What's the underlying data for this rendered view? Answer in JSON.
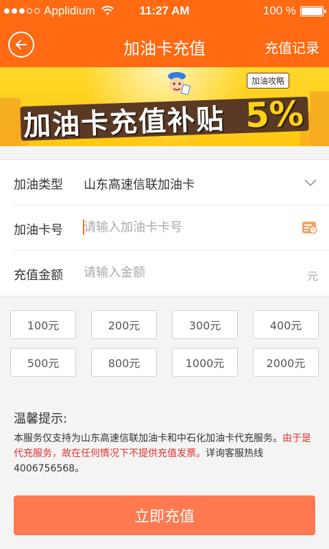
{
  "status_bar": {
    "carrier": "Applidium",
    "time": "11:27 AM",
    "battery": "100 %"
  },
  "nav": {
    "title": "加油卡充值",
    "right_action": "充值记录",
    "back_icon": "back-arrow-icon"
  },
  "banner": {
    "slogan": "加油卡充值补贴",
    "percent": "5%",
    "tag": "加油攻略"
  },
  "form": {
    "type_label": "加油类型",
    "type_value": "山东高速信联加油卡",
    "card_label": "加油卡号",
    "card_placeholder": "请输入加油卡卡号",
    "amount_label": "充值金额",
    "amount_placeholder": "请输入金额",
    "amount_unit": "元"
  },
  "amount_options": [
    "100元",
    "200元",
    "300元",
    "400元",
    "500元",
    "800元",
    "1000元",
    "2000元"
  ],
  "tips": {
    "title": "温馨提示:",
    "text_before": "本服务仅支持为山东高速信联加油卡和中石化加油卡代充服务。",
    "text_red": "由于是代充服务，故在任何情况下不提供充值发票。",
    "text_after": "详询客服热线4006756568。"
  },
  "submit_label": "立即充值",
  "colors": {
    "brand": "#ff6a13",
    "button": "#ff7950",
    "warning_text": "#e23030"
  }
}
